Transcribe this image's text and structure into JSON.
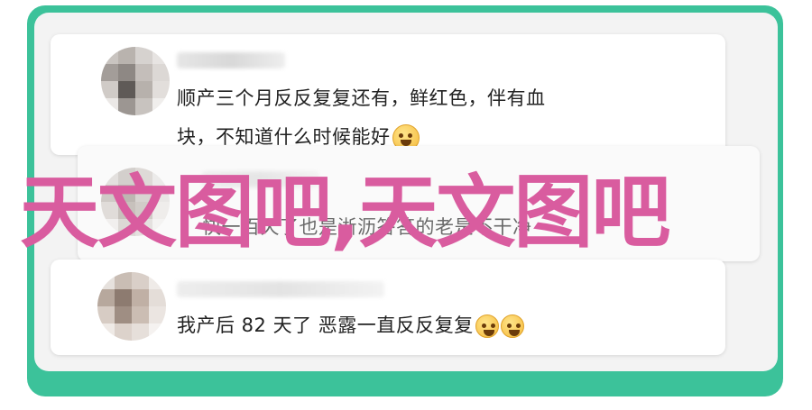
{
  "comments": [
    {
      "line1": "顺产三个月反反复复还有，鲜红色，伴有血",
      "line2": "块，不知道什么时候能好",
      "emoji": "laugh-cry-emoji"
    },
    {
      "line1": "快一百天了也是淅沥答答的老是不干净"
    },
    {
      "line1": "我产后 82 天了 恶露一直反反复复",
      "emoji": "pray-emoji"
    }
  ],
  "watermark": "天文图吧,天文图吧",
  "colors": {
    "frame": "#3cc29a",
    "watermark": "#d95c9f",
    "card": "#ffffff"
  }
}
